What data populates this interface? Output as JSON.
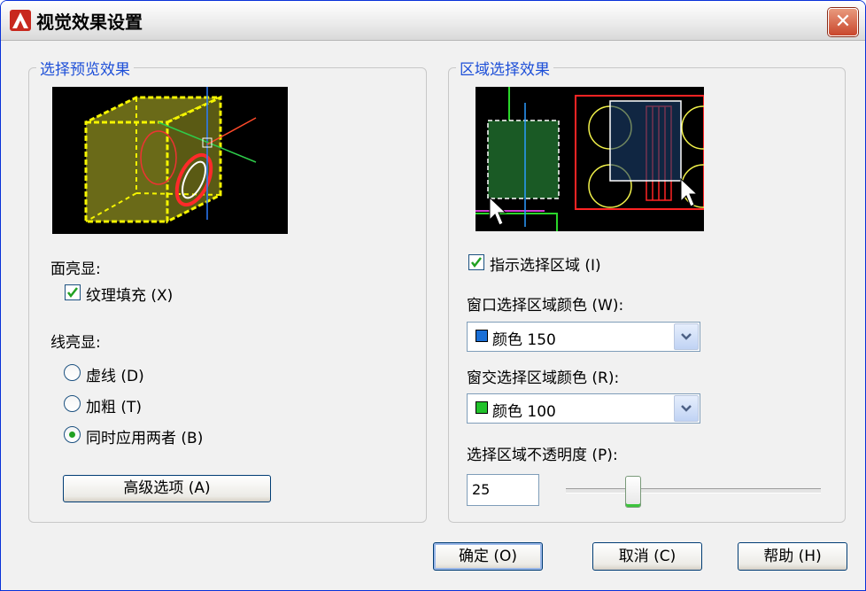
{
  "window": {
    "title": "视觉效果设置",
    "close_glyph": "✕"
  },
  "left_group": {
    "legend": "选择预览效果",
    "face_highlight": {
      "label": "面亮显:",
      "texture_fill": {
        "label": "纹理填充",
        "shortcut": "(X)",
        "checked": true
      }
    },
    "line_highlight": {
      "label": "线亮显:",
      "options": [
        {
          "label": "虚线",
          "shortcut": "(D)",
          "selected": false
        },
        {
          "label": "加粗",
          "shortcut": "(T)",
          "selected": false
        },
        {
          "label": "同时应用两者",
          "shortcut": "(B)",
          "selected": true
        }
      ]
    },
    "advanced_button": {
      "label": "高级选项",
      "shortcut": "(A)"
    }
  },
  "right_group": {
    "legend": "区域选择效果",
    "indicate_area": {
      "label": "指示选择区域",
      "shortcut": "(I)",
      "checked": true
    },
    "window_color": {
      "label": "窗口选择区域颜色",
      "shortcut": "(W)",
      "suffix": ":",
      "value": "颜色 150",
      "swatch": "#1a6fd6"
    },
    "crossing_color": {
      "label": "窗交选择区域颜色",
      "shortcut": "(R)",
      "suffix": ":",
      "value": "颜色 100",
      "swatch": "#22c22c"
    },
    "opacity": {
      "label": "选择区域不透明度",
      "shortcut": "(P)",
      "suffix": ":",
      "value": "25"
    }
  },
  "buttons": {
    "ok": {
      "label": "确定",
      "shortcut": "(O)"
    },
    "cancel": {
      "label": "取消",
      "shortcut": "(C)"
    },
    "help": {
      "label": "帮助",
      "shortcut": "(H)"
    }
  },
  "colors": {
    "legend": "#1d4fd8",
    "check": "#21a121"
  }
}
